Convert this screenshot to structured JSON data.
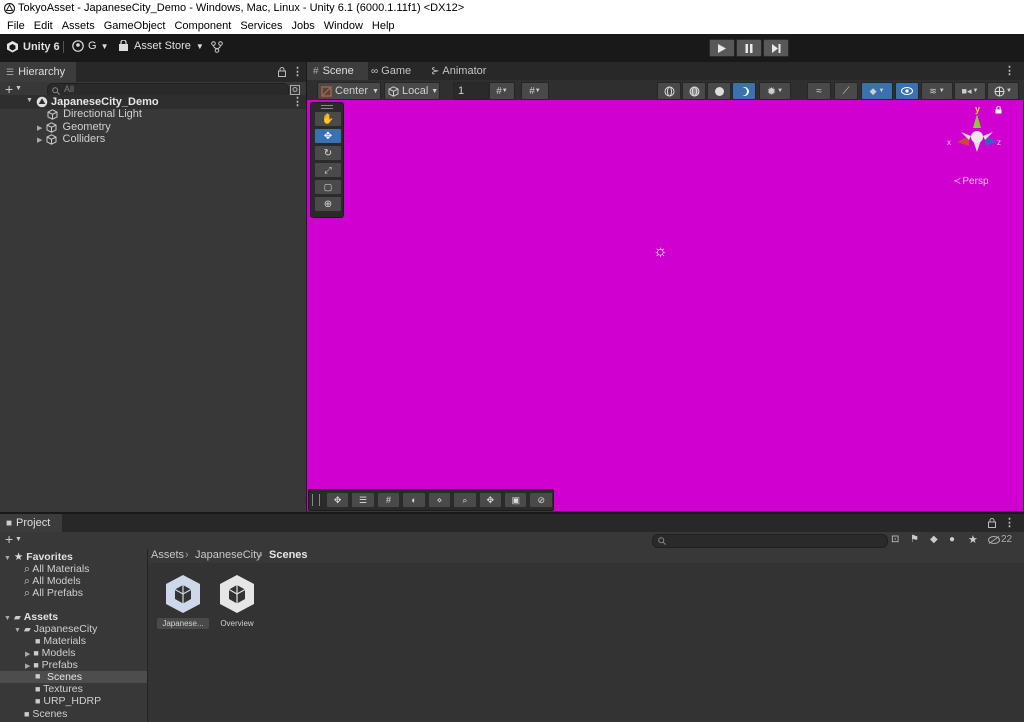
{
  "window": {
    "title": "TokyoAsset - JapaneseCity_Demo - Windows, Mac, Linux - Unity 6.1 (6000.1.11f1) <DX12>"
  },
  "menu": [
    "File",
    "Edit",
    "Assets",
    "GameObject",
    "Component",
    "Services",
    "Jobs",
    "Window",
    "Help"
  ],
  "toolbar": {
    "unity_label": "Unity 6",
    "account_label": "G",
    "asset_store_label": "Asset Store"
  },
  "hierarchy": {
    "tab_label": "Hierarchy",
    "search_placeholder": "All",
    "scene_name": "JapaneseCity_Demo",
    "items": [
      "Directional Light",
      "Geometry",
      "Colliders"
    ]
  },
  "scene_tabs": [
    "Scene",
    "Game",
    "Animator"
  ],
  "scene_toolbar": {
    "pivot": "Center",
    "space": "Local",
    "grid_value": "1"
  },
  "gizmo": {
    "y": "y",
    "x": "x",
    "z": "z",
    "persp": "Persp"
  },
  "project": {
    "tab_label": "Project",
    "hidden_count": "22",
    "favorites": {
      "label": "Favorites",
      "items": [
        "All Materials",
        "All Models",
        "All Prefabs"
      ]
    },
    "assets": {
      "label": "Assets",
      "folder": "JapaneseCity",
      "subfolders": [
        "Materials",
        "Models",
        "Prefabs",
        "Scenes",
        "Textures",
        "URP_HDRP"
      ],
      "root_scenes": "Scenes"
    },
    "breadcrumb": [
      "Assets",
      "JapaneseCity",
      "Scenes"
    ],
    "files": [
      "Japanese...",
      "Overview"
    ]
  },
  "colors": {
    "scene_bg": "#cf00d0",
    "panel": "#383838",
    "accent": "#3a72b0"
  }
}
